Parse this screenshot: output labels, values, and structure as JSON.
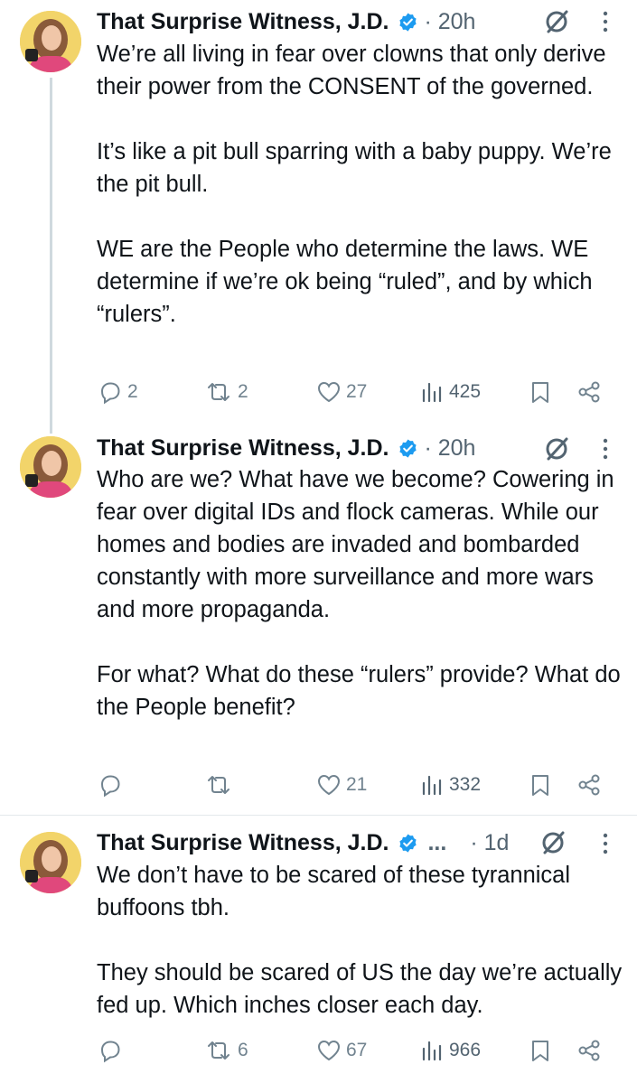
{
  "tweets": [
    {
      "name": "That Surprise Witness, J.D.",
      "time": "· 20h",
      "text": "We’re all living in fear over clowns that only derive their power from the CONSENT of the governed.\n\nIt’s like a pit bull sparring with a baby puppy. We’re the pit bull.\n\nWE are the People who determine the laws. WE determine if we’re ok being “ruled”, and by which “rulers”.",
      "replies": "2",
      "reposts": "2",
      "likes": "27",
      "views": "425"
    },
    {
      "name": "That Surprise Witness, J.D.",
      "time": "· 20h",
      "text": "Who are we? What have we become? Cowering in fear over digital IDs and flock cameras. While our homes and bodies are invaded and bombarded constantly with more surveillance and more wars and more propaganda.\n\nFor what? What do these “rulers” provide? What do the People benefit?",
      "replies": "",
      "reposts": "",
      "likes": "21",
      "views": "332"
    },
    {
      "name": "That Surprise Witness, J.D.",
      "name_overflow": "...",
      "time": "· 1d",
      "text": "We don’t have to be scared of these tyrannical buffoons tbh.\n\nThey should be scared of US the day we’re actually fed up. Which inches closer each day.",
      "replies": "",
      "reposts": "6",
      "likes": "67",
      "views": "966"
    }
  ],
  "icons": {
    "verified": "verified-badge-icon",
    "hide": "hide-post-icon",
    "more": "more-options-icon",
    "reply": "reply-icon",
    "repost": "repost-icon",
    "like": "like-icon",
    "views": "views-icon",
    "bookmark": "bookmark-icon",
    "share": "share-icon"
  },
  "colors": {
    "text": "#0f1419",
    "secondary": "#536471",
    "verified": "#1d9bf0",
    "thread_line": "#cfd9de"
  }
}
